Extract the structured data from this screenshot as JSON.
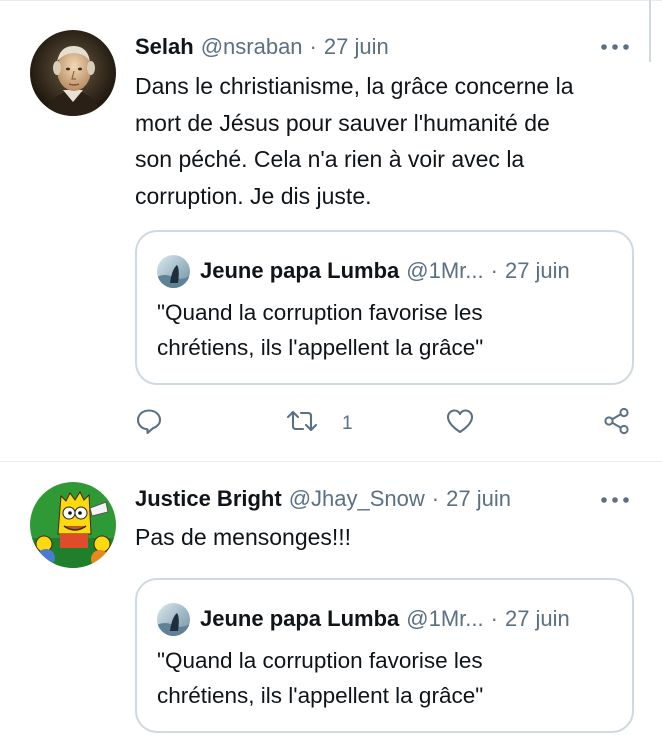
{
  "tweets": [
    {
      "name": "Selah",
      "handle": "@nsraban",
      "dot": "·",
      "date": "27 juin",
      "text_lines": [
        "Dans le christianisme, la grâce concerne la",
        "mort de Jésus pour sauver l'humanité de",
        "son péché. Cela n'a rien à voir avec la",
        "corruption. Je dis juste."
      ],
      "quote": {
        "name": "Jeune papa Lumba",
        "handle": "@1Mr...",
        "dot": "·",
        "date": "27 juin",
        "text_lines": [
          "\"Quand la corruption favorise les",
          "chrétiens, ils l'appellent la grâce\""
        ]
      },
      "retweet_count": "1"
    },
    {
      "name": "Justice Bright",
      "handle": "@Jhay_Snow",
      "dot": "·",
      "date": "27 juin",
      "text_lines": [
        "Pas de mensonges!!!"
      ],
      "quote": {
        "name": "Jeune papa Lumba",
        "handle": "@1Mr...",
        "dot": "·",
        "date": "27 juin",
        "text_lines": [
          "\"Quand la corruption favorise les",
          "chrétiens, ils l'appellent la grâce\""
        ]
      }
    }
  ],
  "icons": {
    "more": "more-horizontal-icon",
    "reply": "reply-icon",
    "retweet": "retweet-icon",
    "like": "heart-icon",
    "share": "share-icon"
  },
  "colors": {
    "text": "#0f1419",
    "secondary": "#5b7083",
    "border": "#cfd9de",
    "divider": "#e6ecf0"
  }
}
